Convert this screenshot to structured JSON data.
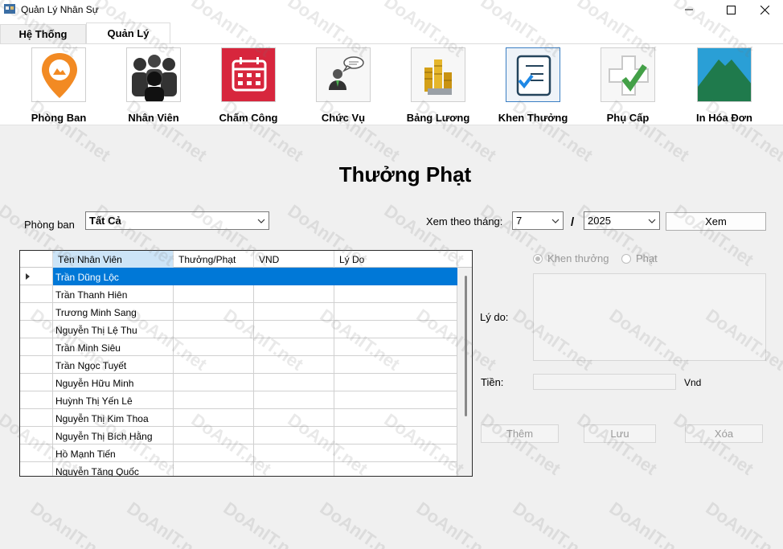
{
  "window": {
    "title": "Quản Lý Nhân Sự"
  },
  "tabs": [
    {
      "label": "Hệ Thống"
    },
    {
      "label": "Quản Lý"
    }
  ],
  "ribbon": [
    {
      "label": "Phòng Ban",
      "icon": "department-pin-icon"
    },
    {
      "label": "Nhân Viên",
      "icon": "employees-icon"
    },
    {
      "label": "Chấm Công",
      "icon": "calendar-icon"
    },
    {
      "label": "Chức Vụ",
      "icon": "position-icon"
    },
    {
      "label": "Bảng Lương",
      "icon": "coins-icon"
    },
    {
      "label": "Khen Thưởng",
      "icon": "checklist-icon"
    },
    {
      "label": "Phụ Cấp",
      "icon": "allowance-icon"
    },
    {
      "label": "In Hóa Đơn",
      "icon": "invoice-icon"
    }
  ],
  "page": {
    "title": "Thưởng Phạt"
  },
  "filter": {
    "department_label": "Phòng ban",
    "department_value": "Tất Cả",
    "month_label": "Xem theo tháng:",
    "month_value": "7",
    "separator": "/",
    "year_value": "2025",
    "view_button": "Xem"
  },
  "grid": {
    "columns": [
      "Tên Nhân Viên",
      "Thưởng/Phạt",
      "VND",
      "Lý Do"
    ],
    "rows": [
      "Trần Dũng Lộc",
      "Trần Thanh Hiên",
      "Trương Minh Sang",
      "Nguyễn Thị Lệ Thu",
      "Trần Minh Siêu",
      "Trần Ngọc Tuyết",
      "Nguyễn Hữu Minh",
      "Huỳnh Thị Yến Lê",
      "Nguyễn Thị Kim Thoa",
      "Nguyễn Thị Bích Hằng",
      "Hồ Mạnh Tiến",
      "Nguyễn Tăng Quốc"
    ]
  },
  "form": {
    "reward_label": "Khen thưởng",
    "penalty_label": "Phạt",
    "reason_label": "Lý do:",
    "money_label": "Tiền:",
    "unit_label": "Vnd",
    "add_button": "Thêm",
    "save_button": "Lưu",
    "delete_button": "Xóa"
  },
  "watermark": "DoAnIT.net",
  "colors": {
    "selection": "#0078d7",
    "accent_border": "#3b7fc4"
  }
}
